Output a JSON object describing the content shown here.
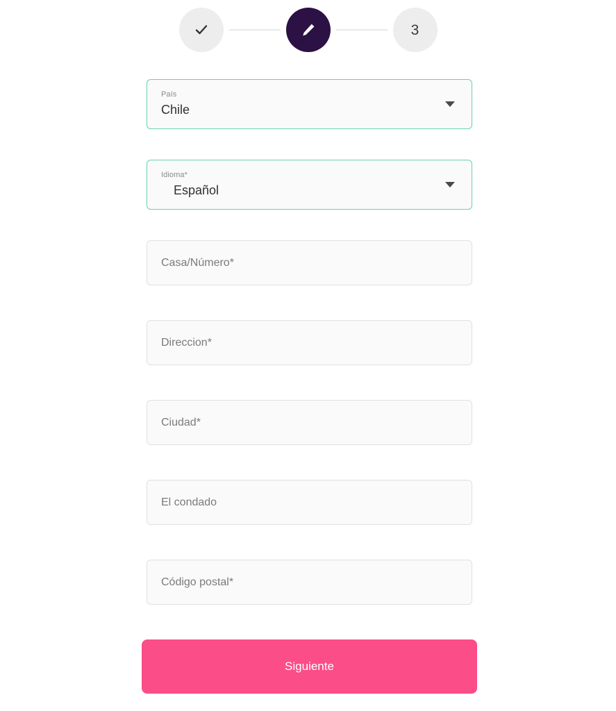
{
  "stepper": {
    "steps": [
      {
        "state": "completed",
        "icon": "check-icon",
        "label": ""
      },
      {
        "state": "active",
        "icon": "pencil-icon",
        "label": ""
      },
      {
        "state": "upcoming",
        "icon": "",
        "label": "3"
      }
    ]
  },
  "form": {
    "country_select": {
      "label": "País",
      "value": "Chile",
      "caret": "chevron-down-icon"
    },
    "language_select": {
      "label": "Idioma*",
      "value": "Español",
      "caret": "chevron-down-icon"
    },
    "house_number": {
      "placeholder": "Casa/Número*",
      "value": ""
    },
    "address": {
      "placeholder": "Direccion*",
      "value": ""
    },
    "city": {
      "placeholder": "Ciudad*",
      "value": ""
    },
    "county": {
      "placeholder": "El condado",
      "value": ""
    },
    "postal_code": {
      "placeholder": "Código postal*",
      "value": ""
    },
    "submit_label": "Siguiente"
  },
  "colors": {
    "accent_pink": "#fb4d88",
    "active_step": "#2c1144",
    "valid_border": "#66d3ab",
    "field_bg": "#fafafa",
    "field_border": "#e0e0e0",
    "inactive_step": "#ededed"
  }
}
